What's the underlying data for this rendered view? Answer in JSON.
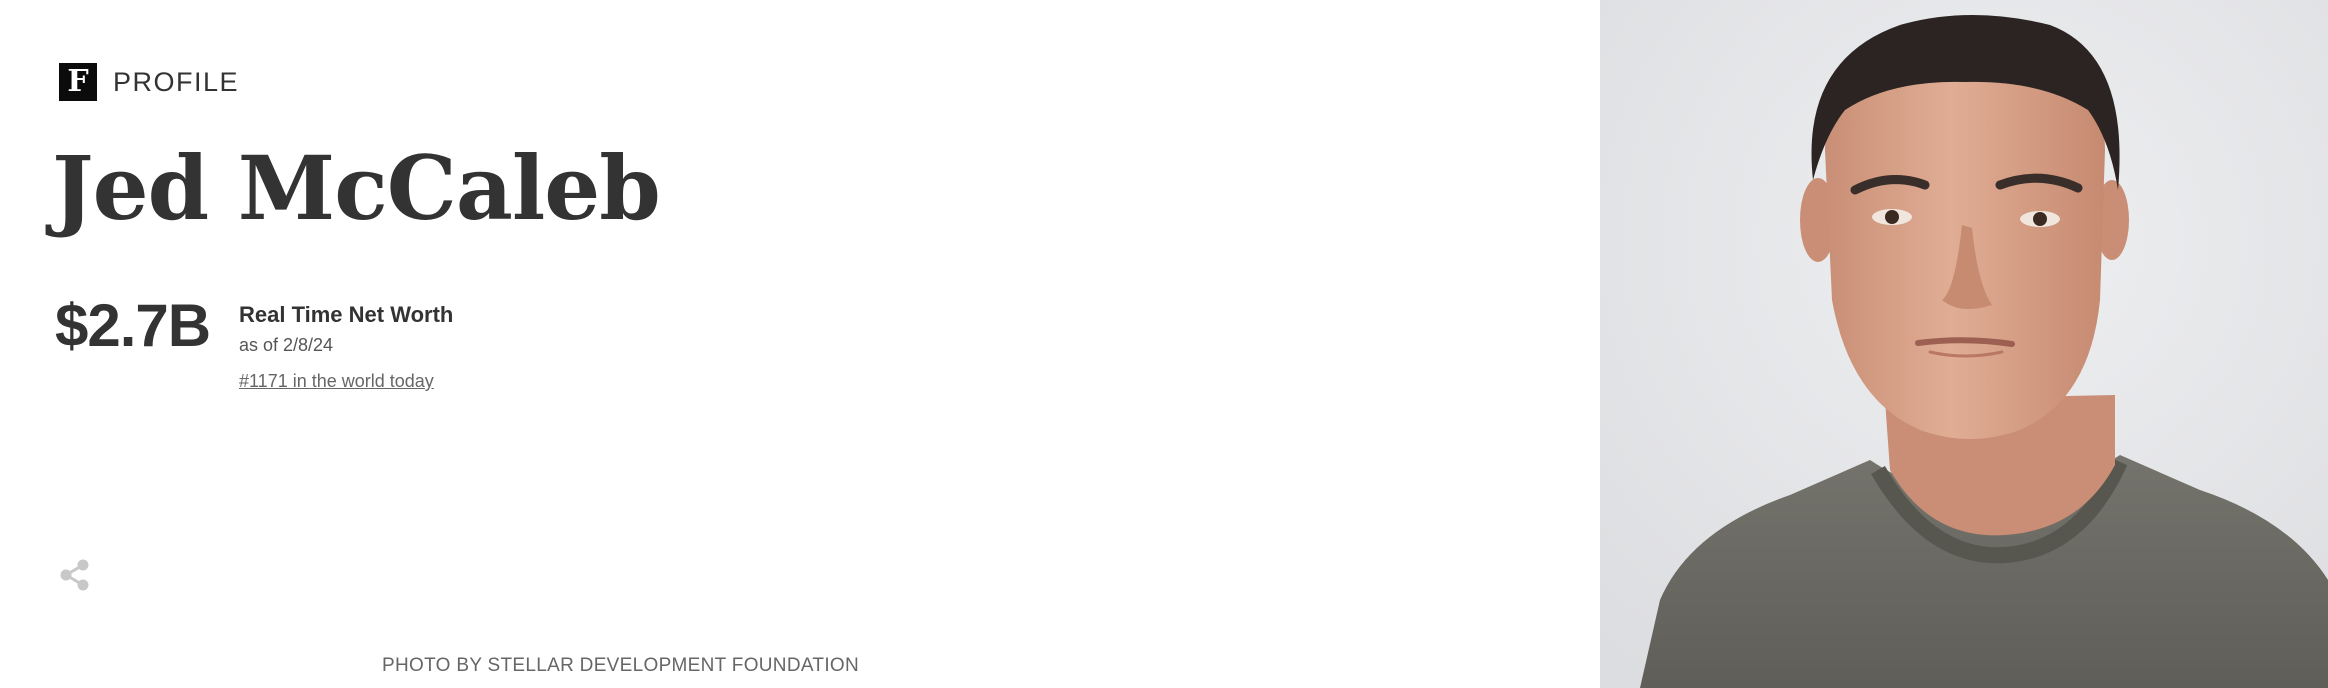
{
  "header": {
    "brand_letter": "F",
    "section_label": "PROFILE"
  },
  "profile": {
    "name": "Jed McCaleb"
  },
  "net_worth": {
    "value": "$2.7B",
    "title": "Real Time Net Worth",
    "as_of": "as of 2/8/24",
    "rank_text": "#1171 in the world today"
  },
  "share": {
    "icon": "share-icon"
  },
  "photo": {
    "credit": "PHOTO BY STELLAR DEVELOPMENT FOUNDATION"
  },
  "colors": {
    "text_primary": "#333333",
    "text_secondary": "#666666",
    "logo_bg": "#0b0b0b",
    "share_icon": "#c8c8c8",
    "photo_bg": "#e6e7e9",
    "shirt": "#6b6a64",
    "skin": "#d9a48a",
    "hair": "#2b2422"
  }
}
